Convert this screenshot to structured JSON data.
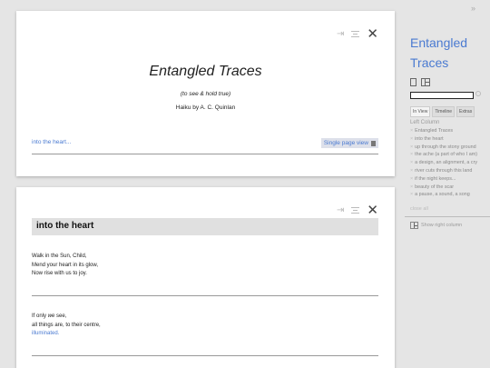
{
  "doc": {
    "tools": {
      "arrow": "⇥",
      "lines": "≡",
      "close": "✕"
    },
    "title": "Entangled Traces",
    "subtitle": "(to see & hold true)",
    "author": "Haiku by A. C. Quinlan",
    "next_link": "into the heart...",
    "single_page_view": "Single page view"
  },
  "poem": {
    "tools": {
      "arrow": "⇥",
      "lines": "≡",
      "close": "✕"
    },
    "heading": "into the heart",
    "stanza1": [
      "Walk in the Sun, Child,",
      "Mend your heart in its glow,",
      "Now rise with us to joy."
    ],
    "stanza2_line1_pre": "If only ",
    "stanza2_line1_em": "we",
    "stanza2_line1_post": " see,",
    "stanza2_line2": "all things are, to their centre,",
    "stanza2_line3": "illuminated."
  },
  "sidebar": {
    "collapse": "»",
    "title_line1": "Entangled",
    "title_line2": "Traces",
    "tabs": [
      "In View",
      "Timeline",
      "Extras"
    ],
    "section": "Left Column",
    "items": [
      "Entangled Traces",
      "into the heart",
      "up through the stony ground",
      "the ache (a part of who I am)",
      "a design, an alignment, a cry",
      "river cuts through this land",
      "if the night keeps...",
      "beauty of the scar",
      "a pause, a sound, a song"
    ],
    "close_all": "close all",
    "show_right": "Show right column"
  }
}
